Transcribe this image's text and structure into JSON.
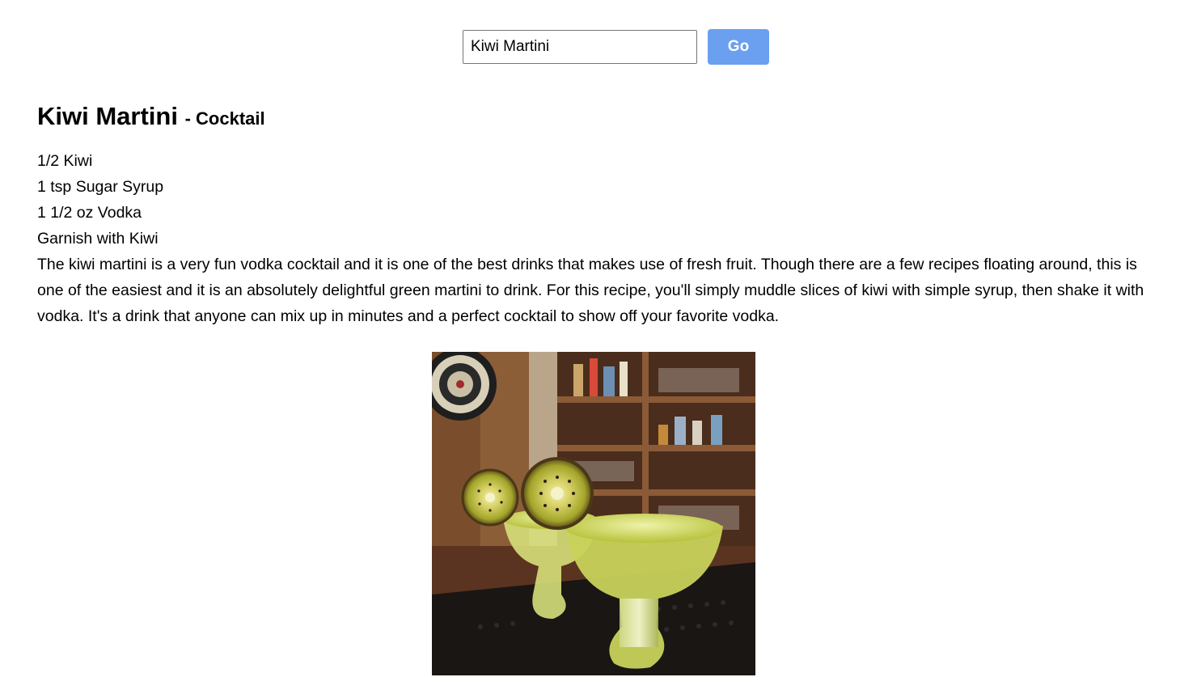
{
  "search": {
    "value": "Kiwi Martini",
    "button_label": "Go"
  },
  "drink": {
    "name": "Kiwi Martini",
    "category": "- Cocktail",
    "ingredients": [
      "1/2 Kiwi",
      "1 tsp Sugar Syrup",
      "1 1/2 oz Vodka"
    ],
    "garnish": "Garnish with Kiwi",
    "description": "The kiwi martini is a very fun vodka cocktail and it is one of the best drinks that makes use of fresh fruit. Though there are a few recipes floating around, this is one of the easiest and it is an absolutely delightful green martini to drink. For this recipe, you'll simply muddle slices of kiwi with simple syrup, then shake it with vodka. It's a drink that anyone can mix up in minutes and a perfect cocktail to show off your favorite vodka."
  }
}
